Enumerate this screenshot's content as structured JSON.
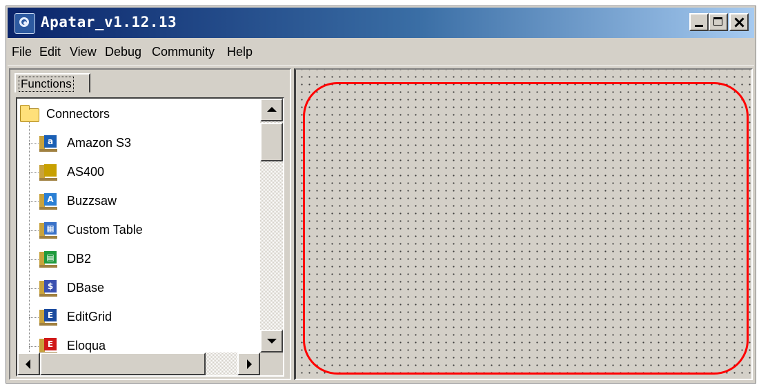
{
  "window": {
    "title": "Apatar_v1.12.13"
  },
  "menu": [
    "File",
    "Edit",
    "View",
    "Debug",
    "Community",
    "Help"
  ],
  "left_panel": {
    "tab_label": "Functions"
  },
  "tree": {
    "root": {
      "label": "Connectors"
    },
    "items": [
      {
        "label": "Amazon S3",
        "icon": "amazon-s3-icon",
        "badge": "a",
        "color": "#1a5fb4"
      },
      {
        "label": "AS400",
        "icon": "as400-icon",
        "badge": "",
        "color": "#c8a000"
      },
      {
        "label": "Buzzsaw",
        "icon": "buzzsaw-icon",
        "badge": "A",
        "color": "#2a7fd4"
      },
      {
        "label": "Custom Table",
        "icon": "custom-table-icon",
        "badge": "▦",
        "color": "#3a72c8"
      },
      {
        "label": "DB2",
        "icon": "db2-icon",
        "badge": "▤",
        "color": "#1e9a3c"
      },
      {
        "label": "DBase",
        "icon": "dbase-icon",
        "badge": "$",
        "color": "#3a50b0"
      },
      {
        "label": "EditGrid",
        "icon": "editgrid-icon",
        "badge": "E",
        "color": "#1a4a9e"
      },
      {
        "label": "Eloqua",
        "icon": "eloqua-icon",
        "badge": "E",
        "color": "#d01818"
      }
    ]
  },
  "canvas": {
    "highlight_color": "#ff0000"
  }
}
